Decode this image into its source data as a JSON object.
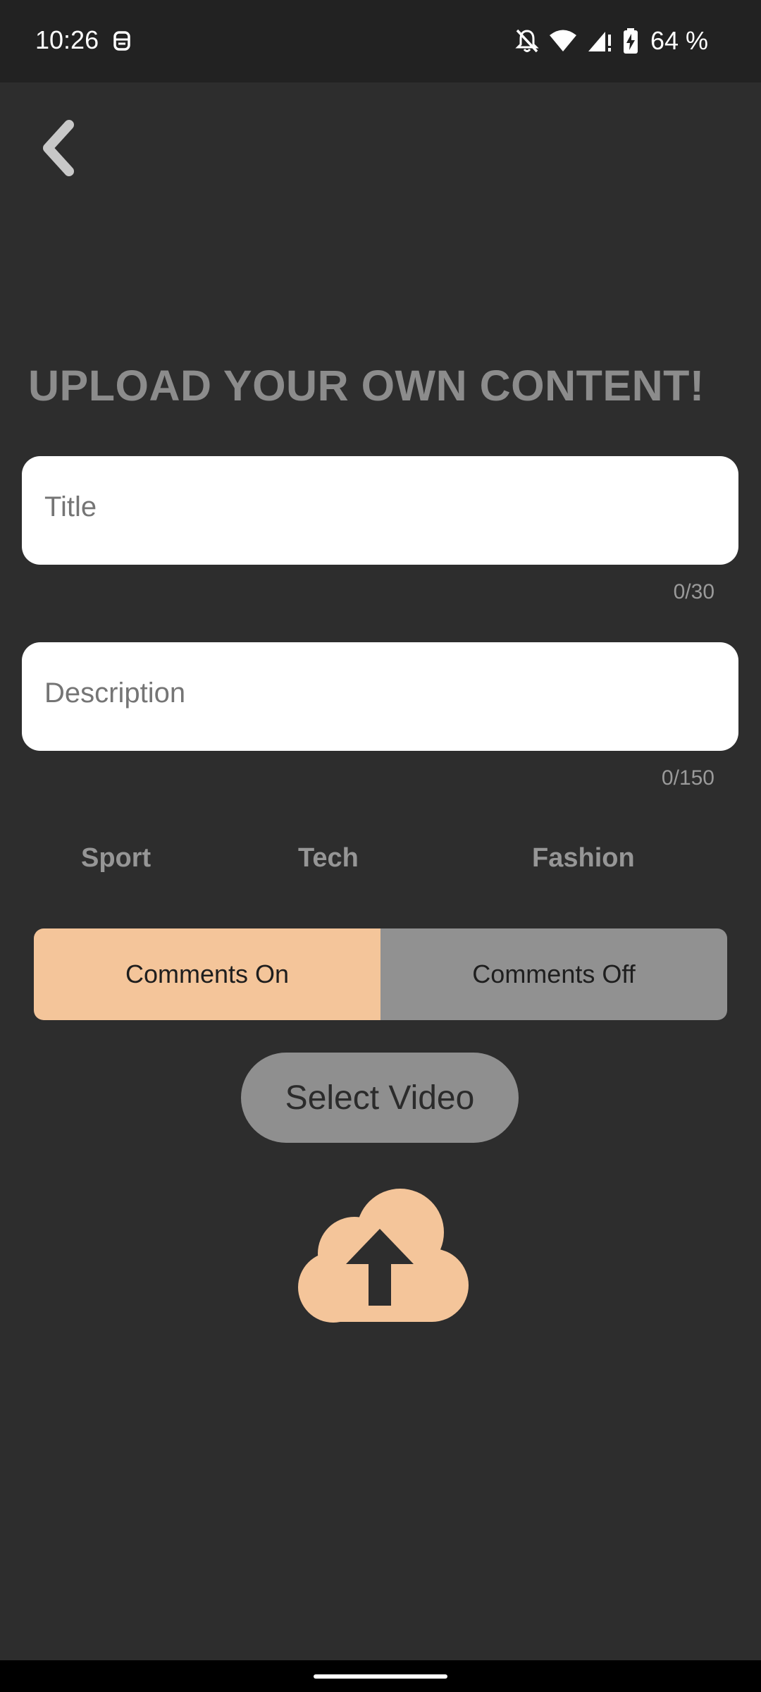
{
  "status_bar": {
    "time": "10:26",
    "battery_percent": "64 %",
    "icons": [
      "notification-monitor-icon",
      "bell-off-icon",
      "wifi-icon",
      "cellular-signal-icon",
      "battery-charging-icon"
    ]
  },
  "header": {
    "back_icon": "chevron-left-icon"
  },
  "page": {
    "title": "UPLOAD YOUR OWN CONTENT!"
  },
  "form": {
    "title_field": {
      "placeholder": "Title",
      "value": "",
      "counter": "0/30"
    },
    "description_field": {
      "placeholder": "Description",
      "value": "",
      "counter": "0/150"
    }
  },
  "categories": [
    "Sport",
    "Tech",
    "Fashion"
  ],
  "comments_toggle": {
    "on_label": "Comments On",
    "off_label": "Comments Off",
    "selected": "Comments On"
  },
  "select_video_label": "Select Video",
  "upload_icon": "cloud-upload-icon",
  "colors": {
    "background": "#2d2d2d",
    "accent": "#f4c59a",
    "muted_gray": "#8f8f8f",
    "title_gray": "#8c8c8c"
  }
}
